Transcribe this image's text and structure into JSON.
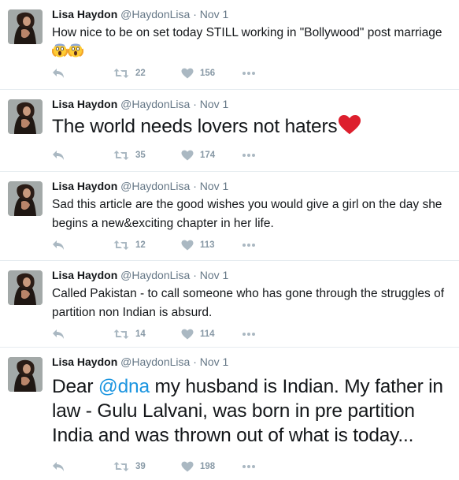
{
  "tweets": [
    {
      "name": "Lisa Haydon",
      "handle": "@HaydonLisa",
      "separator": "·",
      "date": "Nov 1",
      "text": "How nice to be on set today STILL working in \"Bollywood\" post marriage",
      "emoji": "scream-emoji-pair",
      "retweets": "22",
      "likes": "156"
    },
    {
      "name": "Lisa Haydon",
      "handle": "@HaydonLisa",
      "separator": "·",
      "date": "Nov 1",
      "text": "The world needs lovers not haters",
      "emoji": "red-heart-emoji",
      "retweets": "35",
      "likes": "174"
    },
    {
      "name": "Lisa Haydon",
      "handle": "@HaydonLisa",
      "separator": "·",
      "date": "Nov 1",
      "text": "Sad this article are the good wishes you would give a girl on the day she begins a new&exciting chapter in her life.",
      "retweets": "12",
      "likes": "113"
    },
    {
      "name": "Lisa Haydon",
      "handle": "@HaydonLisa",
      "separator": "·",
      "date": "Nov 1",
      "text": "Called Pakistan - to call someone who has gone through the struggles of partition non Indian is absurd.",
      "retweets": "14",
      "likes": "114"
    },
    {
      "name": "Lisa Haydon",
      "handle": "@HaydonLisa",
      "separator": "·",
      "date": "Nov 1",
      "text_prefix": "Dear ",
      "mention": "@dna",
      "text": " my husband is Indian. My father in law - Gulu Lalvani, was born in pre partition India and was thrown out of what is today...",
      "retweets": "39",
      "likes": "198"
    }
  ],
  "colors": {
    "name": "#14171a",
    "meta": "#657786",
    "action": "#aab8c2",
    "mention": "#1b95e0",
    "divider": "#e6ecf0"
  },
  "icons": [
    "reply-icon",
    "retweet-icon",
    "like-icon",
    "more-icon"
  ]
}
